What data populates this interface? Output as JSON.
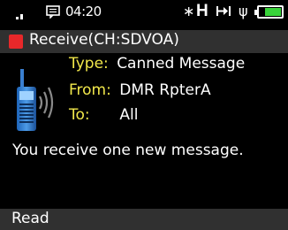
{
  "status_bar": {
    "signal_icon": "signal-bars-icon",
    "message_icon": "message-icon",
    "time": "04:20",
    "bluetooth_icon": "bluetooth-icon",
    "power_label": "H",
    "talkaround_icon": "talkaround-icon",
    "usb_icon": "usb-icon",
    "battery_icon": "battery-icon",
    "battery_level": 0.7,
    "battery_color": "#39d33a"
  },
  "header": {
    "indicator_color": "#e8282a",
    "title": "Receive(CH:SDVOA)"
  },
  "message": {
    "icon": "radio-receive-icon",
    "type_label": "Type:",
    "type_value": "Canned Message",
    "from_label": "From:",
    "from_value": "DMR RpterA",
    "to_label": "To:",
    "to_value": "All",
    "body": "You receive one new message."
  },
  "softkey": {
    "left_label": "Read"
  }
}
